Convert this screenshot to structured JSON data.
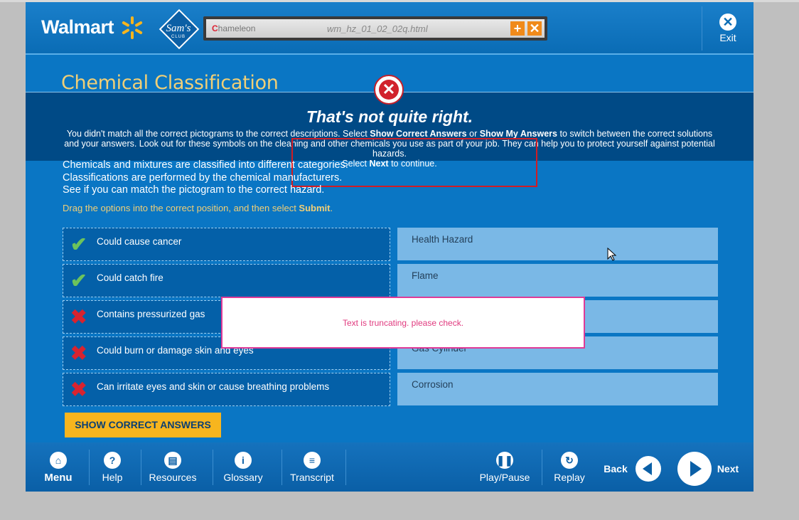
{
  "header": {
    "walmart": "Walmart",
    "sams": "Sam's",
    "sams_club": "CLUB",
    "chameleon_logo": "hameleon",
    "file": "wm_hz_01_02_02q.html",
    "exit_label": "Exit"
  },
  "page": {
    "title": "Chemical Classification"
  },
  "feedback": {
    "title": "That's not quite right.",
    "body_pre": "You didn't match all the correct pictograms to the correct descriptions.  Select ",
    "show_correct": "Show Correct Answers",
    "or": " or ",
    "show_mine": "Show My Answers",
    "body_post": " to switch between the correct solutions and your answers.  Look out for these symbols on the cleaning and other chemicals you use as part of your job.  They can help you to protect yourself against potential hazards.",
    "select": "Select ",
    "next": "Next",
    "continue": " to continue."
  },
  "instructions": {
    "line1": "Chemicals and mixtures are classified into different categories.",
    "line2": "Classifications are performed by the chemical manufacturers.",
    "line3": "See if you can match the pictogram to the correct hazard.",
    "drag_pre": "Drag the options into the correct position, and then select ",
    "drag_submit": "Submit",
    "drag_post": "."
  },
  "options": [
    {
      "label": "Could cause cancer",
      "status": "correct"
    },
    {
      "label": "Could catch fire",
      "status": "correct"
    },
    {
      "label": "Contains pressurized gas",
      "status": "incorrect"
    },
    {
      "label": "Could burn or damage skin and eyes",
      "status": "incorrect"
    },
    {
      "label": "Can irritate eyes and skin or cause breathing problems",
      "status": "incorrect"
    }
  ],
  "targets": [
    "Health Hazard",
    "Flame",
    "",
    "Gas Cylinder",
    "Corrosion"
  ],
  "overlay_note": "Text is truncating. please check.",
  "show_answers_button": "SHOW CORRECT ANSWERS",
  "footer": {
    "menu": "Menu",
    "help": "Help",
    "resources": "Resources",
    "glossary": "Glossary",
    "transcript": "Transcript",
    "play_pause": "Play/Pause",
    "replay": "Replay",
    "back": "Back",
    "next": "Next"
  },
  "colors": {
    "accent": "#f0cf77",
    "primary_blue": "#0a76c4",
    "button_yellow": "#f7b51e",
    "error_red": "#d1222c",
    "correct_green": "#6cc35c"
  }
}
